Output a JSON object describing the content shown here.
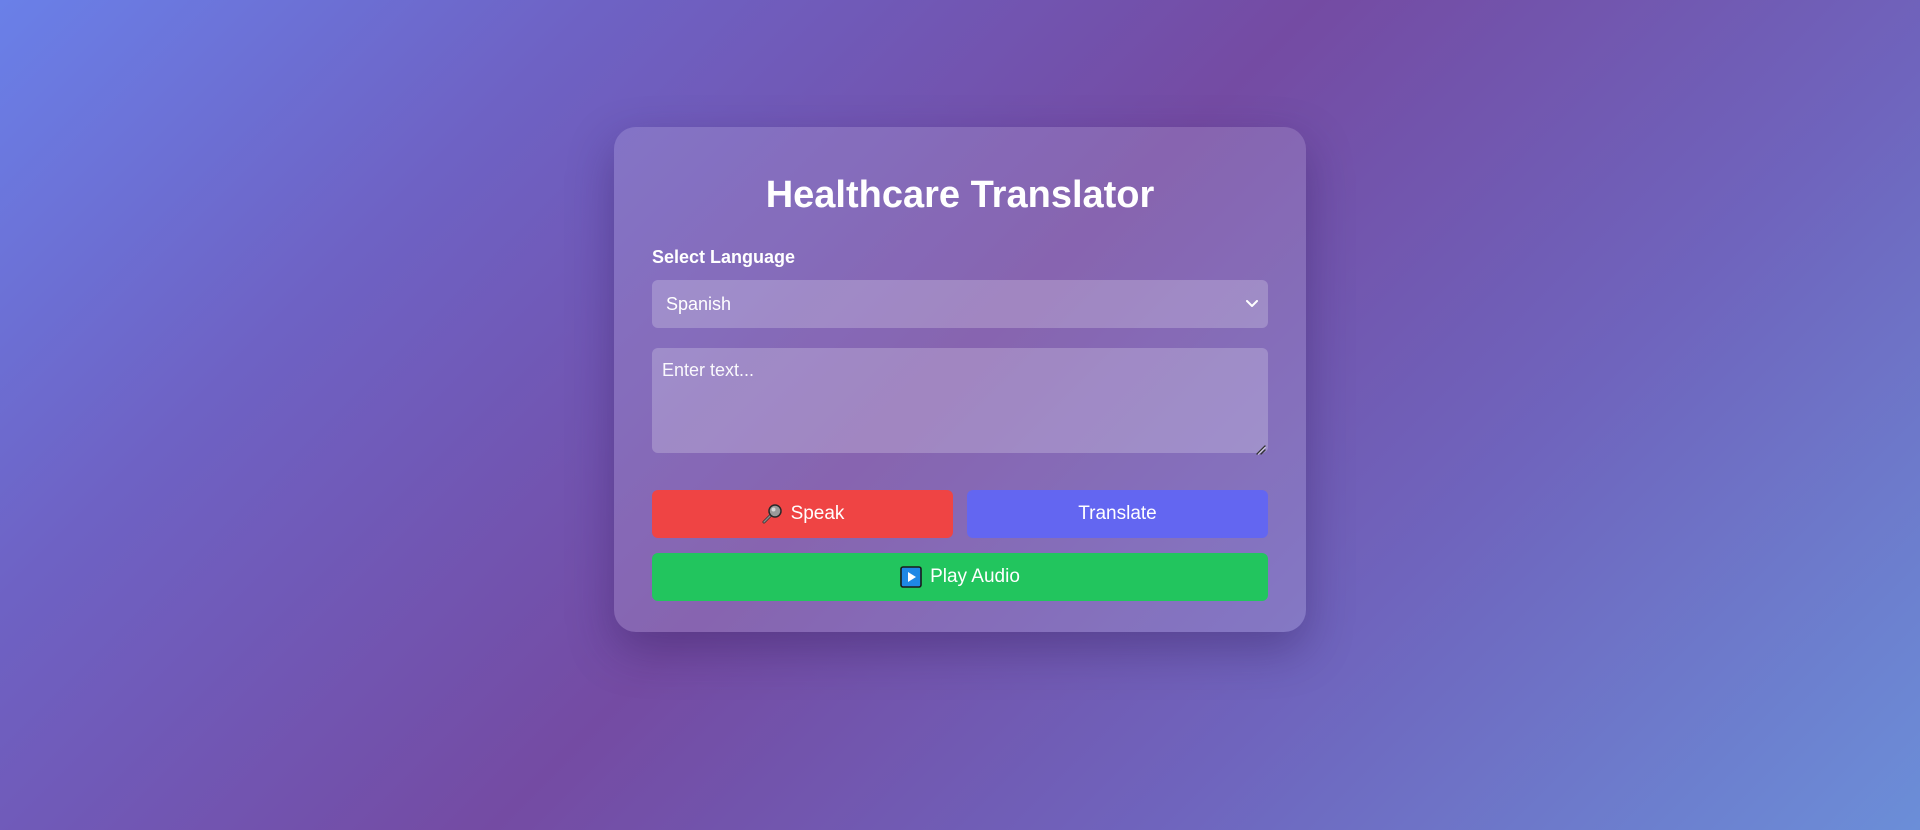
{
  "app": {
    "title": "Healthcare Translator"
  },
  "language": {
    "label": "Select Language",
    "selected": "Spanish"
  },
  "input": {
    "placeholder": "Enter text..."
  },
  "buttons": {
    "speak": "Speak",
    "translate": "Translate",
    "play_audio": "Play Audio"
  },
  "icons": {
    "speak": "microphone-icon",
    "play_audio": "play-button-icon",
    "select": "chevron-down-icon"
  },
  "colors": {
    "speak": "#ef4444",
    "translate": "#6366f1",
    "play_audio": "#22c55e"
  }
}
